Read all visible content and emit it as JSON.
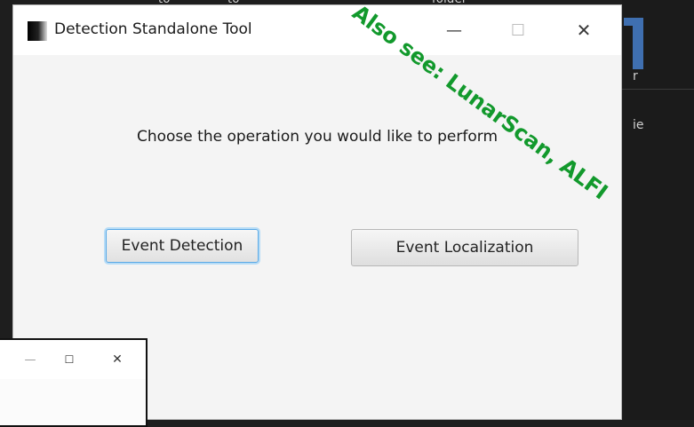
{
  "background": {
    "top_text_fragments": [
      "to",
      "to",
      "folder"
    ],
    "right_panel_chars": [
      "r",
      "ie"
    ]
  },
  "main_window": {
    "title": "Detection Standalone Tool",
    "controls": {
      "minimize": "—",
      "maximize": "☐",
      "close": "✕"
    },
    "prompt": "Choose the operation you would like to perform",
    "buttons": {
      "detection_label": "Event Detection",
      "localization_label": "Event Localization"
    }
  },
  "small_window": {
    "controls": {
      "minimize": "—",
      "maximize": "☐",
      "close": "✕"
    }
  },
  "watermark": {
    "text": "Also see: LunarScan, ALFI"
  },
  "colors": {
    "watermark": "#12992c",
    "focus_ring": "#5aa9e6",
    "dark_background": "#1e1e1e"
  },
  "icons": {
    "app_icon": "app-icon",
    "minimize": "minimize-icon",
    "maximize": "maximize-icon",
    "close": "close-icon"
  }
}
